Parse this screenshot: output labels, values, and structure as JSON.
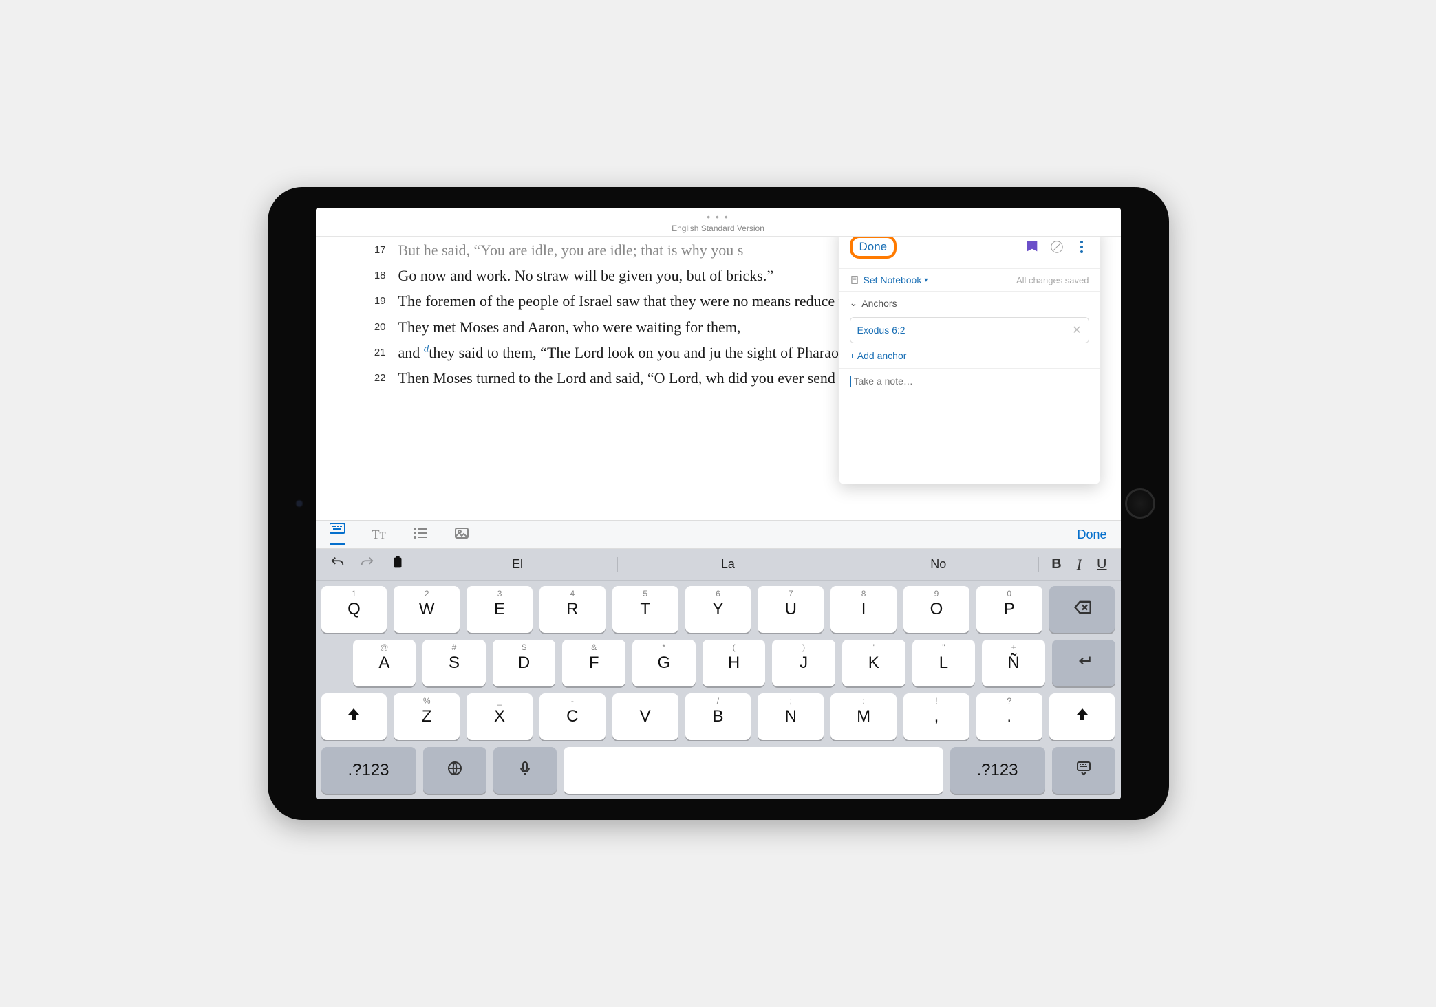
{
  "status": {
    "dots": "• • •",
    "version": "English Standard Version"
  },
  "verses": [
    {
      "num": "17",
      "text": "But he said, “You are idle, you are idle; that is why you s",
      "muted": true
    },
    {
      "num": "18",
      "text": " Go now and work. No straw will be given you, but                                                             of bricks.”"
    },
    {
      "num": "19",
      "text": " The foremen of the people of Israel saw that they were                                                           no means reduce your number of bricks, your daily task ea"
    },
    {
      "num": "20",
      "text": "They met Moses and Aaron, who were waiting for them,"
    },
    {
      "num": "21",
      "pre": "and ",
      "note": "d",
      "post": "they said to them, “The Lord look on you and ju                                                           the sight of Pharaoh and his servants, and have put a sword"
    },
    {
      "num": "22",
      "text": " Then Moses turned to the Lord and said, “O Lord, wh                                                        did you ever send me?"
    }
  ],
  "panel": {
    "done": "Done",
    "set_notebook": "Set Notebook",
    "saved": "All changes saved",
    "anchors_label": "Anchors",
    "anchor_ref": "Exodus 6:2",
    "add_anchor": "+ Add anchor",
    "note_placeholder": "Take a note…"
  },
  "kb_top": {
    "done": "Done"
  },
  "suggestions": [
    "El",
    "La",
    "No"
  ],
  "format": {
    "b": "B",
    "i": "I",
    "u": "U"
  },
  "keys": {
    "row1": [
      {
        "alt": "1",
        "main": "Q"
      },
      {
        "alt": "2",
        "main": "W"
      },
      {
        "alt": "3",
        "main": "E"
      },
      {
        "alt": "4",
        "main": "R"
      },
      {
        "alt": "5",
        "main": "T"
      },
      {
        "alt": "6",
        "main": "Y"
      },
      {
        "alt": "7",
        "main": "U"
      },
      {
        "alt": "8",
        "main": "I"
      },
      {
        "alt": "9",
        "main": "O"
      },
      {
        "alt": "0",
        "main": "P"
      }
    ],
    "row2": [
      {
        "alt": "@",
        "main": "A"
      },
      {
        "alt": "#",
        "main": "S"
      },
      {
        "alt": "$",
        "main": "D"
      },
      {
        "alt": "&",
        "main": "F"
      },
      {
        "alt": "*",
        "main": "G"
      },
      {
        "alt": "(",
        "main": "H"
      },
      {
        "alt": ")",
        "main": "J"
      },
      {
        "alt": "'",
        "main": "K"
      },
      {
        "alt": "\"",
        "main": "L"
      },
      {
        "alt": "+",
        "main": "Ñ"
      }
    ],
    "row3": [
      {
        "alt": "%",
        "main": "Z"
      },
      {
        "alt": "_",
        "main": "X"
      },
      {
        "alt": "-",
        "main": "C"
      },
      {
        "alt": "=",
        "main": "V"
      },
      {
        "alt": "/",
        "main": "B"
      },
      {
        "alt": ";",
        "main": "N"
      },
      {
        "alt": ":",
        "main": "M"
      },
      {
        "alt": "!",
        "main": ","
      },
      {
        "alt": "?",
        "main": "."
      }
    ],
    "numkey": ".?123"
  }
}
